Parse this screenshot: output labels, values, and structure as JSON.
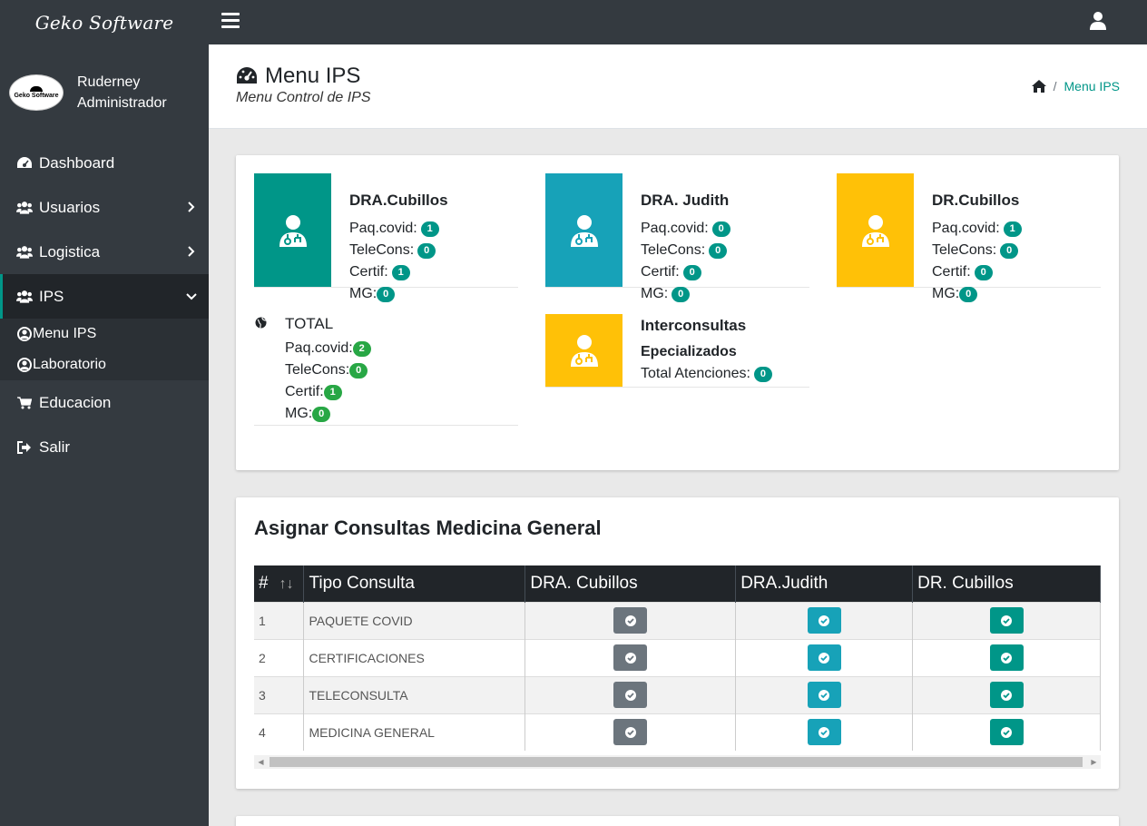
{
  "brand": "Geko Software",
  "user": {
    "first_line": "Ruderney",
    "second_line": "Administrador",
    "logo_text": "Geko Software"
  },
  "sidebar": {
    "items": [
      {
        "label": "Dashboard",
        "icon": "dashboard-icon"
      },
      {
        "label": "Usuarios",
        "icon": "users-icon"
      },
      {
        "label": "Logistica",
        "icon": "users-icon"
      },
      {
        "label": "IPS",
        "icon": "users-icon"
      }
    ],
    "subitems": [
      {
        "label": "Menu IPS",
        "icon": "user-circle-icon"
      },
      {
        "label": "Laboratorio",
        "icon": "user-circle-icon"
      }
    ],
    "bottom": [
      {
        "label": "Educacion",
        "icon": "cart-icon"
      },
      {
        "label": "Salir",
        "icon": "sign-out-icon"
      }
    ]
  },
  "header": {
    "title": "Menu IPS",
    "subtitle": "Menu Control de IPS",
    "breadcrumb": "Menu IPS",
    "breadcrumb_sep": "/"
  },
  "doctors": [
    {
      "name": "DRA.Cubillos",
      "color": "#009688",
      "paq_label": "Paq.covid:",
      "paq": "1",
      "tele_label": "TeleCons:",
      "tele": "0",
      "cert_label": "Certif:",
      "cert": "1",
      "mg_label": "MG:",
      "mg": "0"
    },
    {
      "name": "DRA. Judith",
      "color": "#17a2b8",
      "paq_label": "Paq.covid:",
      "paq": "0",
      "tele_label": "TeleCons:",
      "tele": "0",
      "cert_label": "Certif:",
      "cert": "0",
      "mg_label": "MG:",
      "mg": "0"
    },
    {
      "name": "DR.Cubillos",
      "color": "#ffc107",
      "paq_label": "Paq.covid:",
      "paq": "1",
      "tele_label": "TeleCons:",
      "tele": "0",
      "cert_label": "Certif:",
      "cert": "0",
      "mg_label": "MG:",
      "mg": "0"
    }
  ],
  "total": {
    "title": "TOTAL",
    "paq_label": "Paq.covid:",
    "paq": "2",
    "tele_label": "TeleCons:",
    "tele": "0",
    "cert_label": "Certif:",
    "cert": "1",
    "mg_label": "MG:",
    "mg": "0"
  },
  "inter": {
    "title": "Interconsultas",
    "subtitle": "Epecializados",
    "total_label": "Total Atenciones:",
    "total": "0",
    "color": "#ffc107"
  },
  "table": {
    "title": "Asignar Consultas Medicina General",
    "headers": [
      "#",
      "Tipo Consulta",
      "DRA. Cubillos",
      "DRA.Judith",
      "DR. Cubillos"
    ],
    "rows": [
      {
        "num": "1",
        "tipo": "PAQUETE COVID"
      },
      {
        "num": "2",
        "tipo": "CERTIFICACIONES"
      },
      {
        "num": "3",
        "tipo": "TELECONSULTA"
      },
      {
        "num": "4",
        "tipo": "MEDICINA GENERAL"
      }
    ]
  }
}
